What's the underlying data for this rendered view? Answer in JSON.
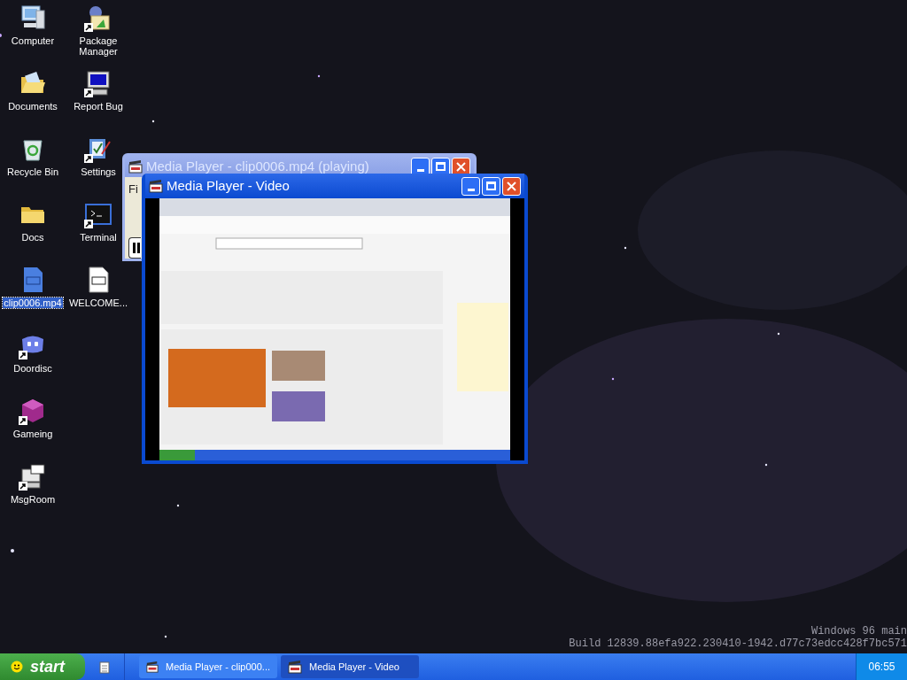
{
  "desktop": {
    "icons": [
      {
        "label": "Computer",
        "kind": "computer",
        "shortcut": false,
        "selected": false
      },
      {
        "label": "Documents",
        "kind": "open-folder",
        "shortcut": false,
        "selected": false
      },
      {
        "label": "Recycle Bin",
        "kind": "bin",
        "shortcut": false,
        "selected": false
      },
      {
        "label": "Docs",
        "kind": "folder",
        "shortcut": false,
        "selected": false
      },
      {
        "label": "clip0006.mp4",
        "kind": "video-file",
        "shortcut": false,
        "selected": true
      },
      {
        "label": "Doordisc",
        "kind": "chat",
        "shortcut": true,
        "selected": false
      },
      {
        "label": "Gameing",
        "kind": "cube",
        "shortcut": true,
        "selected": false
      },
      {
        "label": "MsgRoom",
        "kind": "messenger",
        "shortcut": true,
        "selected": false
      },
      {
        "label": "Package Manager",
        "kind": "package",
        "shortcut": true,
        "selected": false
      },
      {
        "label": "Report Bug",
        "kind": "monitor",
        "shortcut": true,
        "selected": false
      },
      {
        "label": "Settings",
        "kind": "settings",
        "shortcut": true,
        "selected": false
      },
      {
        "label": "Terminal",
        "kind": "terminal",
        "shortcut": true,
        "selected": false
      },
      {
        "label": "WELCOME...",
        "kind": "document",
        "shortcut": false,
        "selected": false
      }
    ]
  },
  "windows": [
    {
      "title": "Media Player - clip0006.mp4 (playing)",
      "active": false,
      "menu": [
        "Fi"
      ],
      "kind": "player"
    },
    {
      "title": "Media Player - Video",
      "active": true,
      "kind": "video"
    }
  ],
  "watermark": [
    "Windows 96 main",
    "Build 12839.88efa922.230410-1942.d77c73edcc428f7bc571"
  ],
  "taskbar": {
    "start": "start",
    "tasks": [
      {
        "label": "Media Player - clip000...",
        "selected": false
      },
      {
        "label": "Media Player - Video",
        "selected": true
      }
    ],
    "clock": "06:55"
  }
}
